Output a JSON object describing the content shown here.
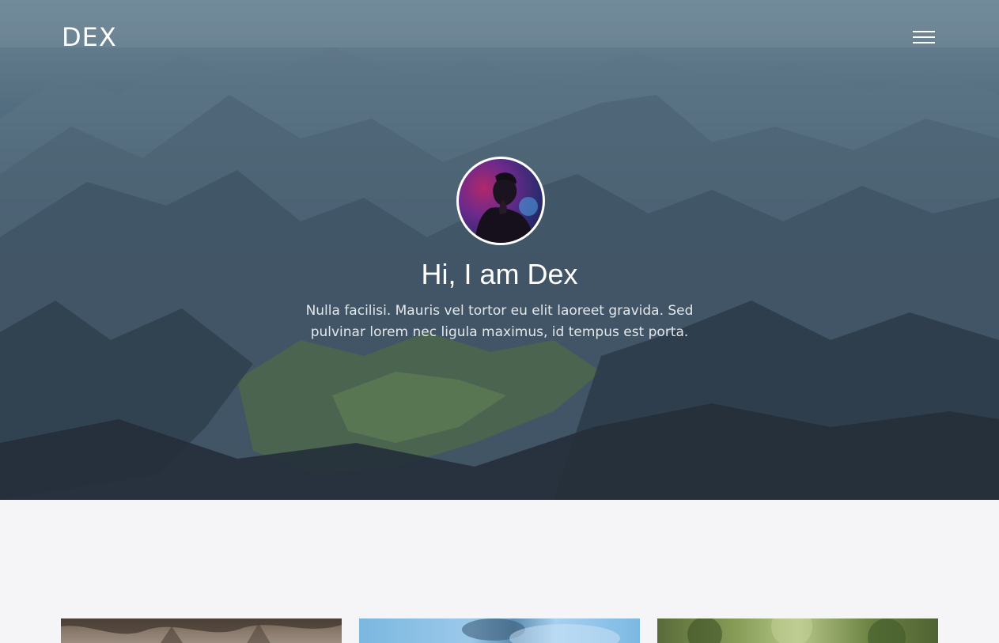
{
  "header": {
    "logo": "DEX",
    "menu_icon": "hamburger-menu-icon"
  },
  "hero": {
    "avatar_icon": "profile-avatar",
    "title": "Hi, I am Dex",
    "text": "Nulla facilisi. Mauris vel tortor eu elit laoreet gravida. Sed pulvinar lorem nec ligula maximus, id tempus est porta."
  },
  "portfolio": {
    "cards": [
      {
        "name": "portfolio-card-1"
      },
      {
        "name": "portfolio-card-2"
      },
      {
        "name": "portfolio-card-3"
      }
    ]
  },
  "colors": {
    "page_background": "#f5f5f8",
    "hero_text": "#ffffff"
  }
}
